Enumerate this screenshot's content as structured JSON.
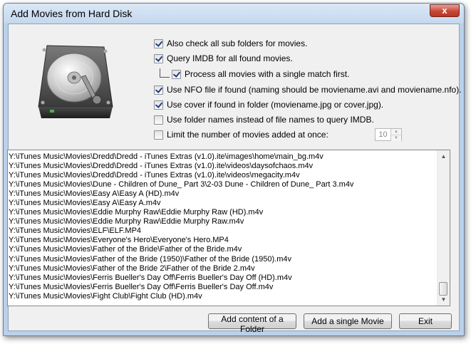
{
  "window": {
    "title": "Add Movies from Hard Disk",
    "close_label": "x"
  },
  "options": {
    "sub_folders": {
      "label": "Also check all sub folders for movies.",
      "checked": true
    },
    "query_imdb": {
      "label": "Query IMDB for all found movies.",
      "checked": true
    },
    "single_match": {
      "label": "Process all movies with a single match first.",
      "checked": true
    },
    "use_nfo": {
      "label": "Use NFO file if found (naming should be moviename.avi and moviename.nfo).",
      "checked": true
    },
    "use_cover": {
      "label": "Use cover if found in folder (moviename.jpg or cover.jpg).",
      "checked": true
    },
    "folder_names": {
      "label": "Use folder names instead of file names to query IMDB.",
      "checked": false
    },
    "limit": {
      "label": "Limit the number of movies added at once:",
      "checked": false,
      "value": "10"
    }
  },
  "file_list": [
    "Y:\\iTunes Music\\Movies\\Dredd\\Dredd - iTunes Extras (v1.0).ite\\images\\home\\main_bg.m4v",
    "Y:\\iTunes Music\\Movies\\Dredd\\Dredd - iTunes Extras (v1.0).ite\\videos\\daysofchaos.m4v",
    "Y:\\iTunes Music\\Movies\\Dredd\\Dredd - iTunes Extras (v1.0).ite\\videos\\megacity.m4v",
    "Y:\\iTunes Music\\Movies\\Dune - Children of Dune_ Part 3\\2-03 Dune - Children of Dune_ Part 3.m4v",
    "Y:\\iTunes Music\\Movies\\Easy A\\Easy A (HD).m4v",
    "Y:\\iTunes Music\\Movies\\Easy A\\Easy A.m4v",
    "Y:\\iTunes Music\\Movies\\Eddie Murphy Raw\\Eddie Murphy Raw (HD).m4v",
    "Y:\\iTunes Music\\Movies\\Eddie Murphy Raw\\Eddie Murphy Raw.m4v",
    "Y:\\iTunes Music\\Movies\\ELF\\ELF.MP4",
    "Y:\\iTunes Music\\Movies\\Everyone's Hero\\Everyone's Hero.MP4",
    "Y:\\iTunes Music\\Movies\\Father of the Bride\\Father of the Bride.m4v",
    "Y:\\iTunes Music\\Movies\\Father of the Bride (1950)\\Father of the Bride (1950).m4v",
    "Y:\\iTunes Music\\Movies\\Father of the Bride 2\\Father of the Bride 2.m4v",
    "Y:\\iTunes Music\\Movies\\Ferris Bueller's Day Off\\Ferris Bueller's Day Off (HD).m4v",
    "Y:\\iTunes Music\\Movies\\Ferris Bueller's Day Off\\Ferris Bueller's Day Off.m4v",
    "Y:\\iTunes Music\\Movies\\Fight Club\\Fight Club (HD).m4v"
  ],
  "scroll": {
    "up_glyph": "▲",
    "down_glyph": "▼",
    "spin_up": "▲",
    "spin_down": "▼"
  },
  "buttons": {
    "add_folder": "Add content of a Folder",
    "add_single": "Add a single Movie",
    "exit": "Exit"
  },
  "colors": {
    "frame": "#b9d1ea",
    "client": "#f0f0f0",
    "close_button": "#c8473a",
    "check_mark": "#1e3d8c"
  },
  "icons": {
    "drive": "hard-disk-icon"
  }
}
